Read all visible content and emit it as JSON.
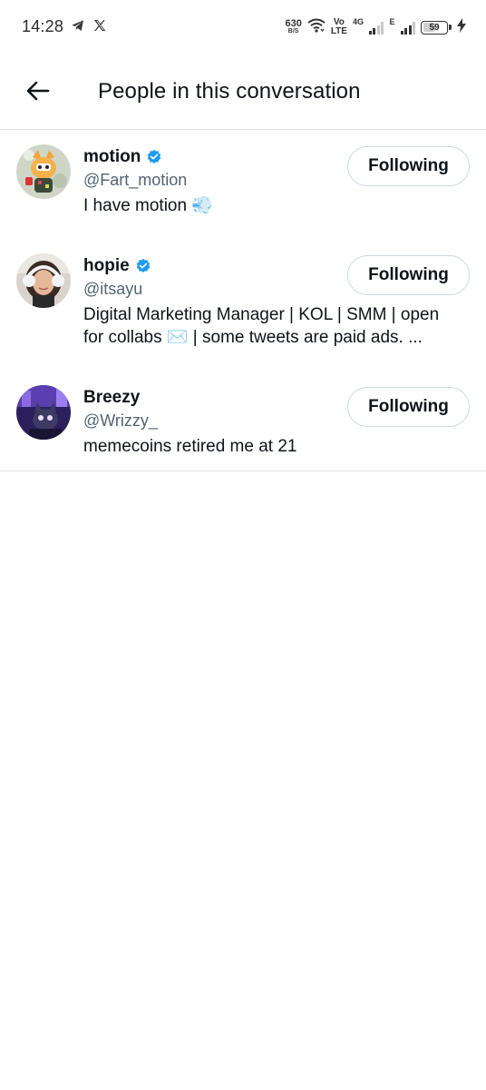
{
  "status_bar": {
    "time": "14:28",
    "left_icons": [
      "telegram-icon",
      "x-logo-icon"
    ],
    "net_speed": "630",
    "net_speed_unit": "B/S",
    "volte_top": "Vo",
    "volte_bottom": "LTE",
    "network_4g": "4G",
    "network_e": "E",
    "battery_level": "59",
    "battery_fraction": 0.59,
    "charging": true
  },
  "header": {
    "title": "People in this conversation",
    "back_icon": "arrow-left-icon"
  },
  "people": [
    {
      "name": "motion",
      "verified": true,
      "handle": "@Fart_motion",
      "bio": "I have motion 💨",
      "button": "Following"
    },
    {
      "name": "hopie",
      "verified": true,
      "handle": "@itsayu",
      "bio": "Digital Marketing Manager | KOL | SMM | open for collabs ✉️ | some tweets are paid ads. ...",
      "button": "Following"
    },
    {
      "name": "Breezy",
      "verified": false,
      "handle": "@Wrizzy_",
      "bio": "memecoins retired me at 21",
      "button": "Following"
    }
  ],
  "colors": {
    "text_primary": "#0f1419",
    "text_secondary": "#536471",
    "verified_blue": "#1d9bf0",
    "divider": "#e1e4e8",
    "button_border": "#cfd9de"
  }
}
